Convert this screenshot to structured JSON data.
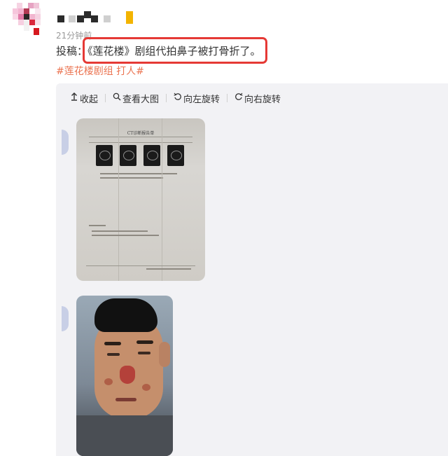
{
  "post": {
    "time": "21分钟前",
    "prefix": "投稿：",
    "quoted_text": "《莲花楼》剧组代拍鼻子被打骨折了。",
    "hashtags": [
      "#莲花楼剧组 打人#"
    ]
  },
  "toolbar": {
    "collapse_label": "收起",
    "view_large_label": "查看大图",
    "rotate_left_label": "向左旋转",
    "rotate_right_label": "向右旋转",
    "icons": {
      "collapse": "collapse-up-icon",
      "view_large": "magnifier-icon",
      "rotate_left": "rotate-left-icon",
      "rotate_right": "rotate-right-icon"
    }
  },
  "images": [
    {
      "name": "ct-report-photo",
      "content": "CT诊断报告单"
    },
    {
      "name": "injured-face-photo"
    }
  ],
  "colors": {
    "hashtag": "#eb7350",
    "highlight_border": "#e53935",
    "panel_bg": "#f2f2f5",
    "meta_text": "#999999"
  }
}
